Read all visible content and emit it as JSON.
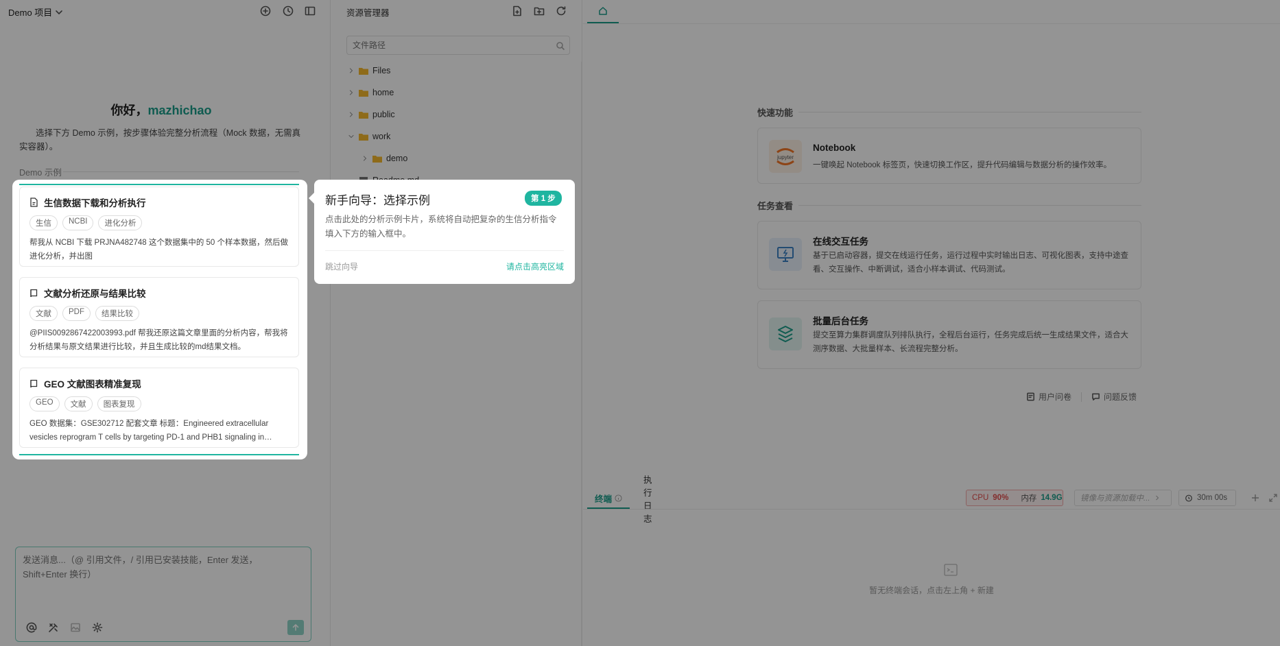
{
  "colors": {
    "accent": "#1a9e8a",
    "accent_light": "#1fb5a0",
    "danger": "#e24d4d"
  },
  "left": {
    "project_name": "Demo 项目",
    "greeting_prefix": "你好，",
    "username": "mazhichao",
    "intro": "选择下方 Demo 示例，按步骤体验完整分析流程（Mock 数据，无需真实容器）。",
    "demo_label": "Demo 示例",
    "cards": [
      {
        "title": "生信数据下载和分析执行",
        "tags": [
          "生信",
          "NCBI",
          "进化分析"
        ],
        "desc": "帮我从 NCBI 下载 PRJNA482748 这个数据集中的 50 个样本数据，然后做进化分析，并出图"
      },
      {
        "title": "文献分析还原与结果比较",
        "tags": [
          "文献",
          "PDF",
          "结果比较"
        ],
        "desc": "@PIIS0092867422003993.pdf 帮我还原这篇文章里面的分析内容，帮我将分析结果与原文结果进行比较，并且生成比较的md结果文档。"
      },
      {
        "title": "GEO 文献图表精准复现",
        "tags": [
          "GEO",
          "文献",
          "图表复现"
        ],
        "desc": "GEO 数据集：GSE302712 配套文章 标题：Engineered extracellular vesicles reprogram T cells by targeting PD-1 and PHB1 signaling in…"
      }
    ],
    "chat_placeholder": "发送消息...（@ 引用文件，/ 引用已安装技能，Enter 发送，Shift+Enter 换行）"
  },
  "explorer": {
    "title": "资源管理器",
    "search_placeholder": "文件路径",
    "tree": [
      {
        "name": "Files"
      },
      {
        "name": "home"
      },
      {
        "name": "public"
      },
      {
        "name": "work"
      },
      {
        "name": "demo"
      },
      {
        "name": "Readme.md"
      }
    ]
  },
  "right": {
    "quick_label": "快速功能",
    "task_label": "任务查看",
    "notebook": {
      "icon_text": "jupyter",
      "title": "Notebook",
      "desc": "一键唤起 Notebook 标签页，快速切换工作区，提升代码编辑与数据分析的操作效率。"
    },
    "online": {
      "title": "在线交互任务",
      "desc": "基于已启动容器，提交在线运行任务，运行过程中实时输出日志、可视化图表，支持中途查看、交互操作、中断调试，适合小样本调试、代码测试。"
    },
    "batch": {
      "title": "批量后台任务",
      "desc": "提交至算力集群调度队列排队执行，全程后台运行，任务完成后统一生成结果文件，适合大测序数据、大批量样本、长流程完整分析。"
    },
    "link_survey": "用户问卷",
    "link_feedback": "问题反馈",
    "terminal_tab": "终端",
    "log_tab": "执行日志",
    "cpu_label": "CPU",
    "cpu_value": "90%",
    "mem_label": "内存",
    "mem_value": "14.9G",
    "mirror_text": "镜像与资源加载中...",
    "timer": "30m 00s",
    "empty_text": "暂无终端会话，点击左上角 + 新建"
  },
  "guide": {
    "title": "新手向导：选择示例",
    "step": "第 1 步",
    "body": "点击此处的分析示例卡片，系统将自动把复杂的生信分析指令填入下方的输入框中。",
    "skip": "跳过向导",
    "hint": "请点击高亮区域"
  }
}
